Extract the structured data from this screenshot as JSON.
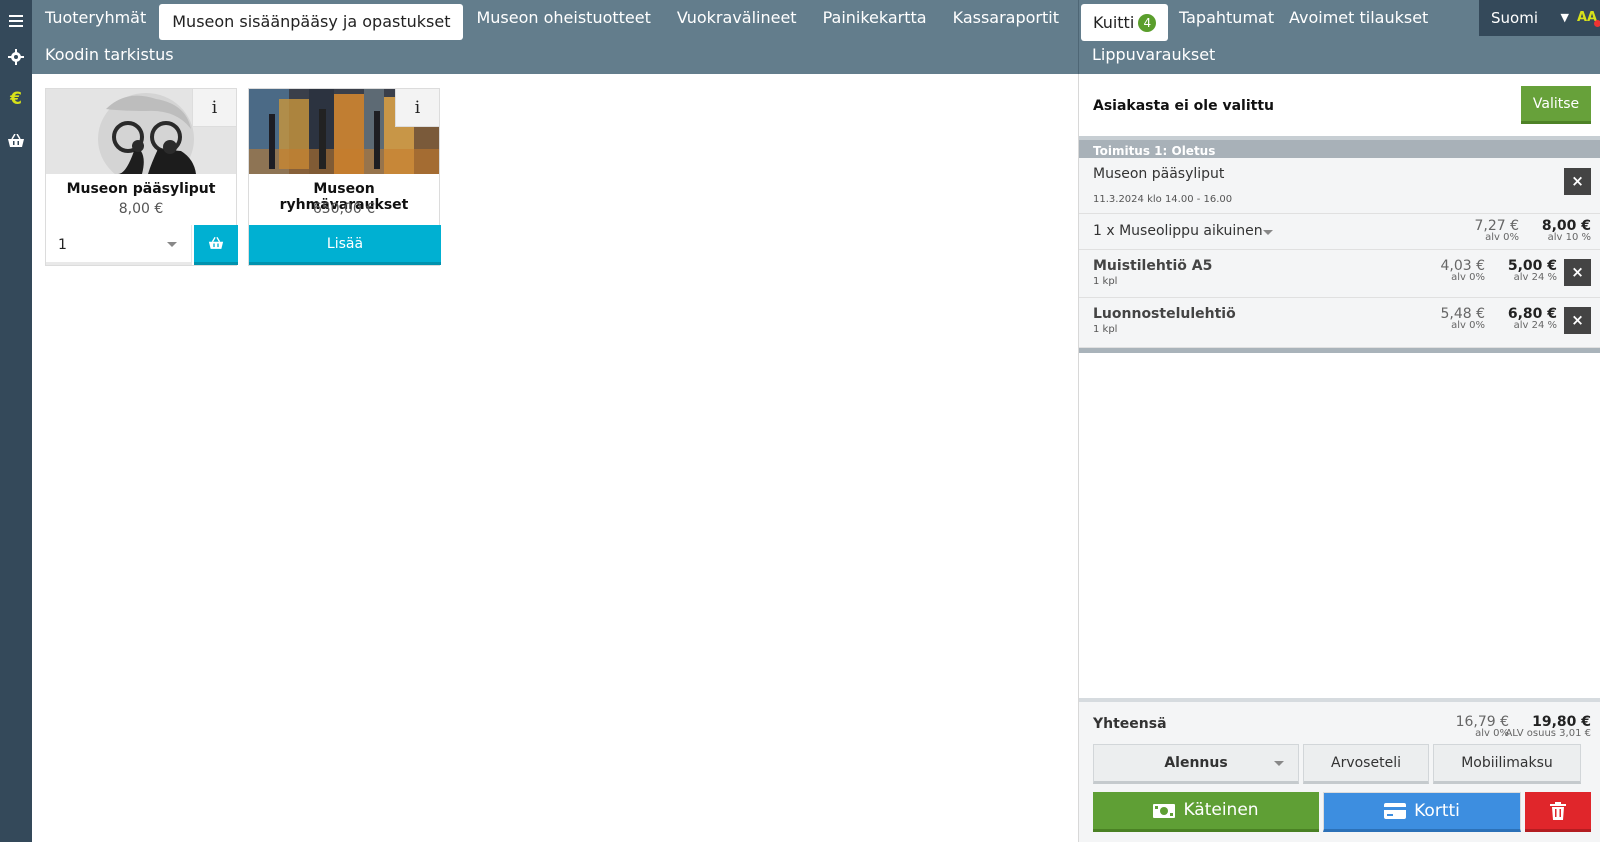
{
  "nav": {
    "tabs": [
      "Tuoteryhmät",
      "Museon sisäänpääsy ja opastukset",
      "Museon oheistuotteet",
      "Vuokravälineet",
      "Painikekartta",
      "Kassaraportit"
    ],
    "row2_link": "Koodin tarkistus"
  },
  "right_nav": {
    "receipt_label": "Kuitti",
    "receipt_count": "4",
    "events": "Tapahtumat",
    "open_orders": "Avoimet tilaukset",
    "language": "Suomi",
    "font_toggle": "AA",
    "row2_link": "Lippuvaraukset"
  },
  "products": [
    {
      "name": "Museon pääsyliput",
      "price": "8,00 €",
      "qty": "1",
      "info": "i"
    },
    {
      "name": "Museon ryhmävaraukset",
      "price": "650,00 €",
      "add_label": "Lisää",
      "info": "i"
    }
  ],
  "cart": {
    "customer_text": "Asiakasta ei ole valittu",
    "select_label": "Valitse",
    "delivery_label": "Toimitus 1: Oletus",
    "group": {
      "name": "Museon pääsyliput",
      "date": "11.3.2024 klo 14.00 - 16.00",
      "close": "×"
    },
    "lines": [
      {
        "name": "1 x Museolippu aikuinen",
        "sub": "",
        "net": "7,27 €",
        "net_vat": "alv 0%",
        "gross": "8,00 €",
        "gross_vat": "alv 10 %"
      },
      {
        "name": "Muistilehtiö A5",
        "sub": "1 kpl",
        "net": "4,03 €",
        "net_vat": "alv 0%",
        "gross": "5,00 €",
        "gross_vat": "alv 24 %",
        "close": "×"
      },
      {
        "name": "Luonnostelulehtiö",
        "sub": "1 kpl",
        "net": "5,48 €",
        "net_vat": "alv 0%",
        "gross": "6,80 €",
        "gross_vat": "alv 24 %",
        "close": "×"
      }
    ],
    "totals": {
      "label": "Yhteensä",
      "net": "16,79 €",
      "net_vat": "alv 0%",
      "gross": "19,80 €",
      "gross_vat": "ALV osuus 3,01 €"
    },
    "buttons": {
      "discount": "Alennus",
      "voucher": "Arvoseteli",
      "mobile": "Mobiilimaksu",
      "cash": "Käteinen",
      "card": "Kortti"
    }
  },
  "colors": {
    "header": "#637d8c",
    "rail": "#34495a",
    "accent_cyan": "#00b0d2",
    "green": "#5f9f35",
    "blue": "#3d8ee0",
    "red": "#e0262b",
    "yellow": "#d7e21a"
  },
  "icons": [
    "menu-icon",
    "gear-icon",
    "euro-icon",
    "basket-icon",
    "info-icon",
    "close-icon",
    "cash-icon",
    "card-icon",
    "trash-icon",
    "chevron-down-icon"
  ]
}
